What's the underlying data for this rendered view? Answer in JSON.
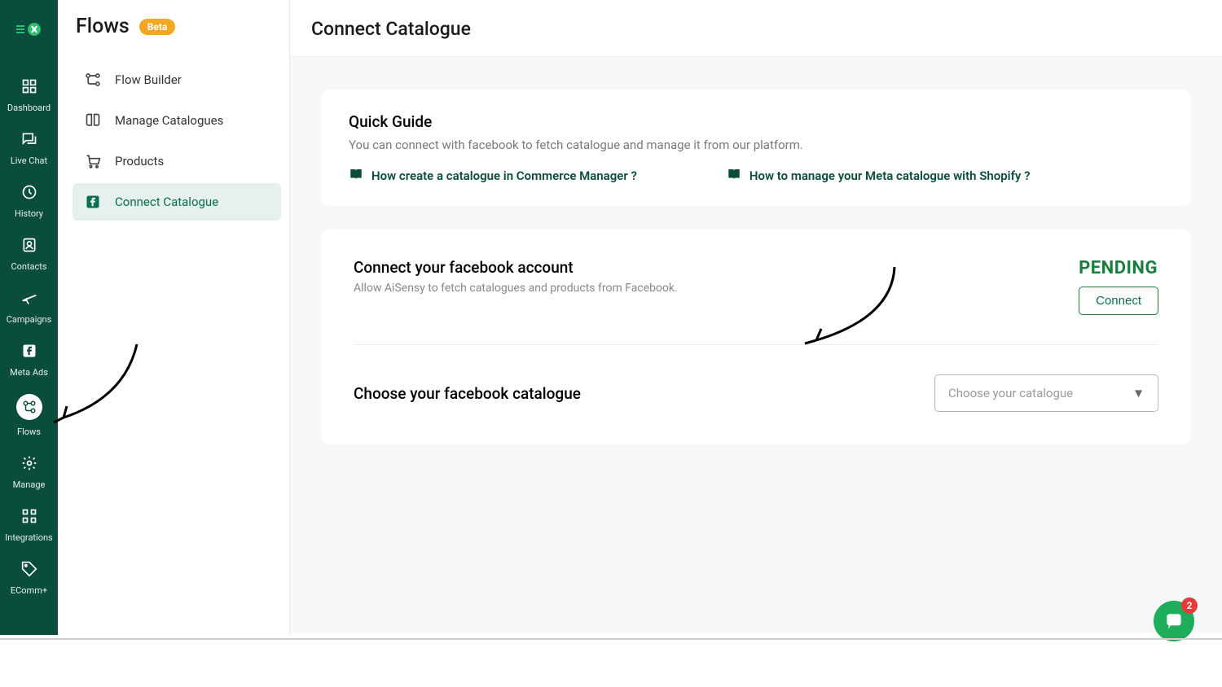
{
  "primary_nav": {
    "items": [
      {
        "label": "Dashboard",
        "icon": "dashboard"
      },
      {
        "label": "Live Chat",
        "icon": "chat"
      },
      {
        "label": "History",
        "icon": "history"
      },
      {
        "label": "Contacts",
        "icon": "contacts"
      },
      {
        "label": "Campaigns",
        "icon": "campaigns"
      },
      {
        "label": "Meta Ads",
        "icon": "facebook"
      },
      {
        "label": "Flows",
        "icon": "flows",
        "active": true
      },
      {
        "label": "Manage",
        "icon": "gear"
      },
      {
        "label": "Integrations",
        "icon": "integrations"
      },
      {
        "label": "EComm+",
        "icon": "tag"
      }
    ]
  },
  "secondary_nav": {
    "title": "Flows",
    "badge": "Beta",
    "items": [
      {
        "label": "Flow Builder"
      },
      {
        "label": "Manage Catalogues"
      },
      {
        "label": "Products"
      },
      {
        "label": "Connect Catalogue",
        "active": true
      }
    ]
  },
  "main": {
    "title": "Connect Catalogue",
    "guide": {
      "title": "Quick Guide",
      "desc": "You can connect with facebook to fetch catalogue and manage it from our platform.",
      "link1": "How create a catalogue in Commerce Manager ?",
      "link2": "How to manage your Meta catalogue with Shopify ?"
    },
    "connect": {
      "title": "Connect your facebook account",
      "desc": "Allow AiSensy to fetch catalogues and products from Facebook.",
      "status": "PENDING",
      "button": "Connect"
    },
    "choose": {
      "title": "Choose your facebook catalogue",
      "placeholder": "Choose your catalogue"
    }
  },
  "chat": {
    "badge": "2"
  }
}
